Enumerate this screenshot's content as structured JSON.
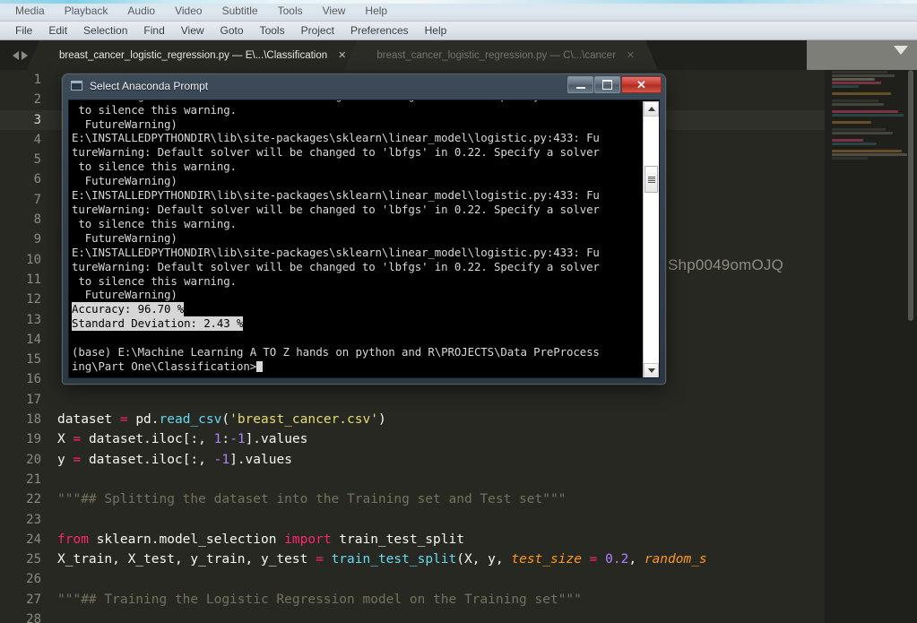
{
  "media_player_menu": {
    "items": [
      "Media",
      "Playback",
      "Audio",
      "Video",
      "Subtitle",
      "Tools",
      "View",
      "Help"
    ]
  },
  "editor_menu": {
    "items": [
      "File",
      "Edit",
      "Selection",
      "Find",
      "View",
      "Goto",
      "Tools",
      "Project",
      "Preferences",
      "Help"
    ]
  },
  "tabs": {
    "nav_prev": "◀",
    "nav_next": "▶",
    "close_glyph": "✕",
    "dropdown_icon": "chevron-down-icon",
    "items": [
      {
        "label": "breast_cancer_logistic_regression.py — E\\...\\Classification",
        "active": true
      },
      {
        "label": "breast_cancer_logistic_regression.py — C\\...\\cancer",
        "active": false
      }
    ]
  },
  "editor": {
    "watermark": "Shp0049omOJQ",
    "current_line": 3,
    "first_line": 1,
    "lines": [
      {
        "n": 1,
        "tokens": []
      },
      {
        "n": 2,
        "tokens": []
      },
      {
        "n": 3,
        "tokens": []
      },
      {
        "n": 4,
        "tokens": []
      },
      {
        "n": 5,
        "tokens": []
      },
      {
        "n": 6,
        "tokens": []
      },
      {
        "n": 7,
        "tokens": []
      },
      {
        "n": 8,
        "tokens": []
      },
      {
        "n": 9,
        "tokens": []
      },
      {
        "n": 10,
        "tokens": []
      },
      {
        "n": 11,
        "tokens": []
      },
      {
        "n": 12,
        "tokens": []
      },
      {
        "n": 13,
        "tokens": []
      },
      {
        "n": 14,
        "tokens": []
      },
      {
        "n": 15,
        "tokens": []
      },
      {
        "n": 16,
        "tokens": []
      },
      {
        "n": 17,
        "tokens": []
      },
      {
        "n": 18,
        "tokens": [
          {
            "t": "dataset ",
            "c": "t-plain"
          },
          {
            "t": "= ",
            "c": "t-op"
          },
          {
            "t": "pd.",
            "c": "t-plain"
          },
          {
            "t": "read_csv",
            "c": "t-fn"
          },
          {
            "t": "(",
            "c": "t-plain"
          },
          {
            "t": "'breast_cancer.csv'",
            "c": "t-str"
          },
          {
            "t": ")",
            "c": "t-plain"
          }
        ]
      },
      {
        "n": 19,
        "tokens": [
          {
            "t": "X ",
            "c": "t-plain"
          },
          {
            "t": "= ",
            "c": "t-op"
          },
          {
            "t": "dataset.iloc[:, ",
            "c": "t-plain"
          },
          {
            "t": "1",
            "c": "t-num"
          },
          {
            "t": ":",
            "c": "t-plain"
          },
          {
            "t": "-1",
            "c": "t-num"
          },
          {
            "t": "].values",
            "c": "t-plain"
          }
        ]
      },
      {
        "n": 20,
        "tokens": [
          {
            "t": "y ",
            "c": "t-plain"
          },
          {
            "t": "= ",
            "c": "t-op"
          },
          {
            "t": "dataset.iloc[:, ",
            "c": "t-plain"
          },
          {
            "t": "-1",
            "c": "t-num"
          },
          {
            "t": "].values",
            "c": "t-plain"
          }
        ]
      },
      {
        "n": 21,
        "tokens": []
      },
      {
        "n": 22,
        "tokens": [
          {
            "t": "\"\"\"## Splitting the dataset into the Training set and Test set\"\"\"",
            "c": "t-comment"
          }
        ]
      },
      {
        "n": 23,
        "tokens": []
      },
      {
        "n": 24,
        "tokens": [
          {
            "t": "from ",
            "c": "t-kw"
          },
          {
            "t": "sklearn.model_selection ",
            "c": "t-plain"
          },
          {
            "t": "import ",
            "c": "t-kw"
          },
          {
            "t": "train_test_split",
            "c": "t-plain"
          }
        ]
      },
      {
        "n": 25,
        "tokens": [
          {
            "t": "X_train, X_test, y_train, y_test ",
            "c": "t-plain"
          },
          {
            "t": "= ",
            "c": "t-op"
          },
          {
            "t": "train_test_split",
            "c": "t-fn"
          },
          {
            "t": "(X, y, ",
            "c": "t-plain"
          },
          {
            "t": "test_size ",
            "c": "t-param"
          },
          {
            "t": "= ",
            "c": "t-op"
          },
          {
            "t": "0.2",
            "c": "t-num"
          },
          {
            "t": ", ",
            "c": "t-plain"
          },
          {
            "t": "random_s",
            "c": "t-param"
          }
        ]
      },
      {
        "n": 26,
        "tokens": []
      },
      {
        "n": 27,
        "tokens": [
          {
            "t": "\"\"\"## Training the Logistic Regression model on the Training set\"\"\"",
            "c": "t-comment"
          }
        ]
      },
      {
        "n": 28,
        "tokens": []
      }
    ]
  },
  "console": {
    "title": "Select Anaconda Prompt",
    "icon": "cmd-window-icon",
    "window_buttons": {
      "minimize": "minimize-icon",
      "maximize": "maximize-icon",
      "close": "✕"
    },
    "scrollbar": {
      "up_arrow": "scroll-up-icon",
      "down_arrow": "scroll-down-icon"
    },
    "lines": [
      " to silence this warning.",
      "  FutureWarning)",
      "E:\\INSTALLEDPYTHONDIR\\lib\\site-packages\\sklearn\\linear_model\\logistic.py:433: Fu",
      "tureWarning: Default solver will be changed to 'lbfgs' in 0.22. Specify a solver",
      " to silence this warning.",
      "  FutureWarning)",
      "E:\\INSTALLEDPYTHONDIR\\lib\\site-packages\\sklearn\\linear_model\\logistic.py:433: Fu",
      "tureWarning: Default solver will be changed to 'lbfgs' in 0.22. Specify a solver",
      " to silence this warning.",
      "  FutureWarning)",
      "E:\\INSTALLEDPYTHONDIR\\lib\\site-packages\\sklearn\\linear_model\\logistic.py:433: Fu",
      "tureWarning: Default solver will be changed to 'lbfgs' in 0.22. Specify a solver",
      " to silence this warning.",
      "  FutureWarning)",
      "E:\\INSTALLEDPYTHONDIR\\lib\\site-packages\\sklearn\\linear_model\\logistic.py:433: Fu",
      "tureWarning: Default solver will be changed to 'lbfgs' in 0.22. Specify a solver",
      " to silence this warning.",
      "  FutureWarning)"
    ],
    "selected_lines": [
      "Accuracy: 96.70 %",
      "Standard Deviation: 2.43 %"
    ],
    "prompt_line": "(base) E:\\Machine Learning A TO Z hands on python and R\\PROJECTS\\Data PreProcess",
    "prompt_line_2": "ing\\Part One\\Classification>"
  }
}
